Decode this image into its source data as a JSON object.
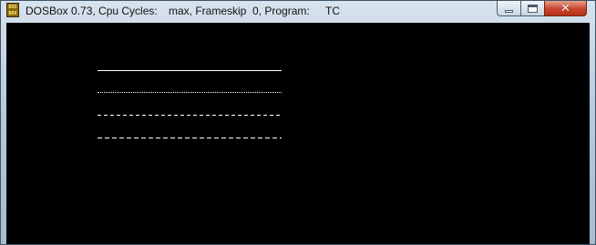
{
  "window": {
    "icon_text": "DOS BOX",
    "title_segments": {
      "app": "DOSBox 0.73, Cpu Cycles:",
      "cycles": "max, Frameskip  0, Program:",
      "program": "TC"
    },
    "buttons": {
      "minimize_icon": "minimize-icon",
      "maximize_icon": "maximize-icon",
      "close_icon": "close-icon",
      "close_glyph": "✕"
    }
  },
  "screen": {
    "background": "#000000",
    "line_color": "#ffffff",
    "lines": [
      {
        "style": "solid"
      },
      {
        "style": "dotted"
      },
      {
        "style": "dashed"
      },
      {
        "style": "dashed"
      }
    ]
  }
}
